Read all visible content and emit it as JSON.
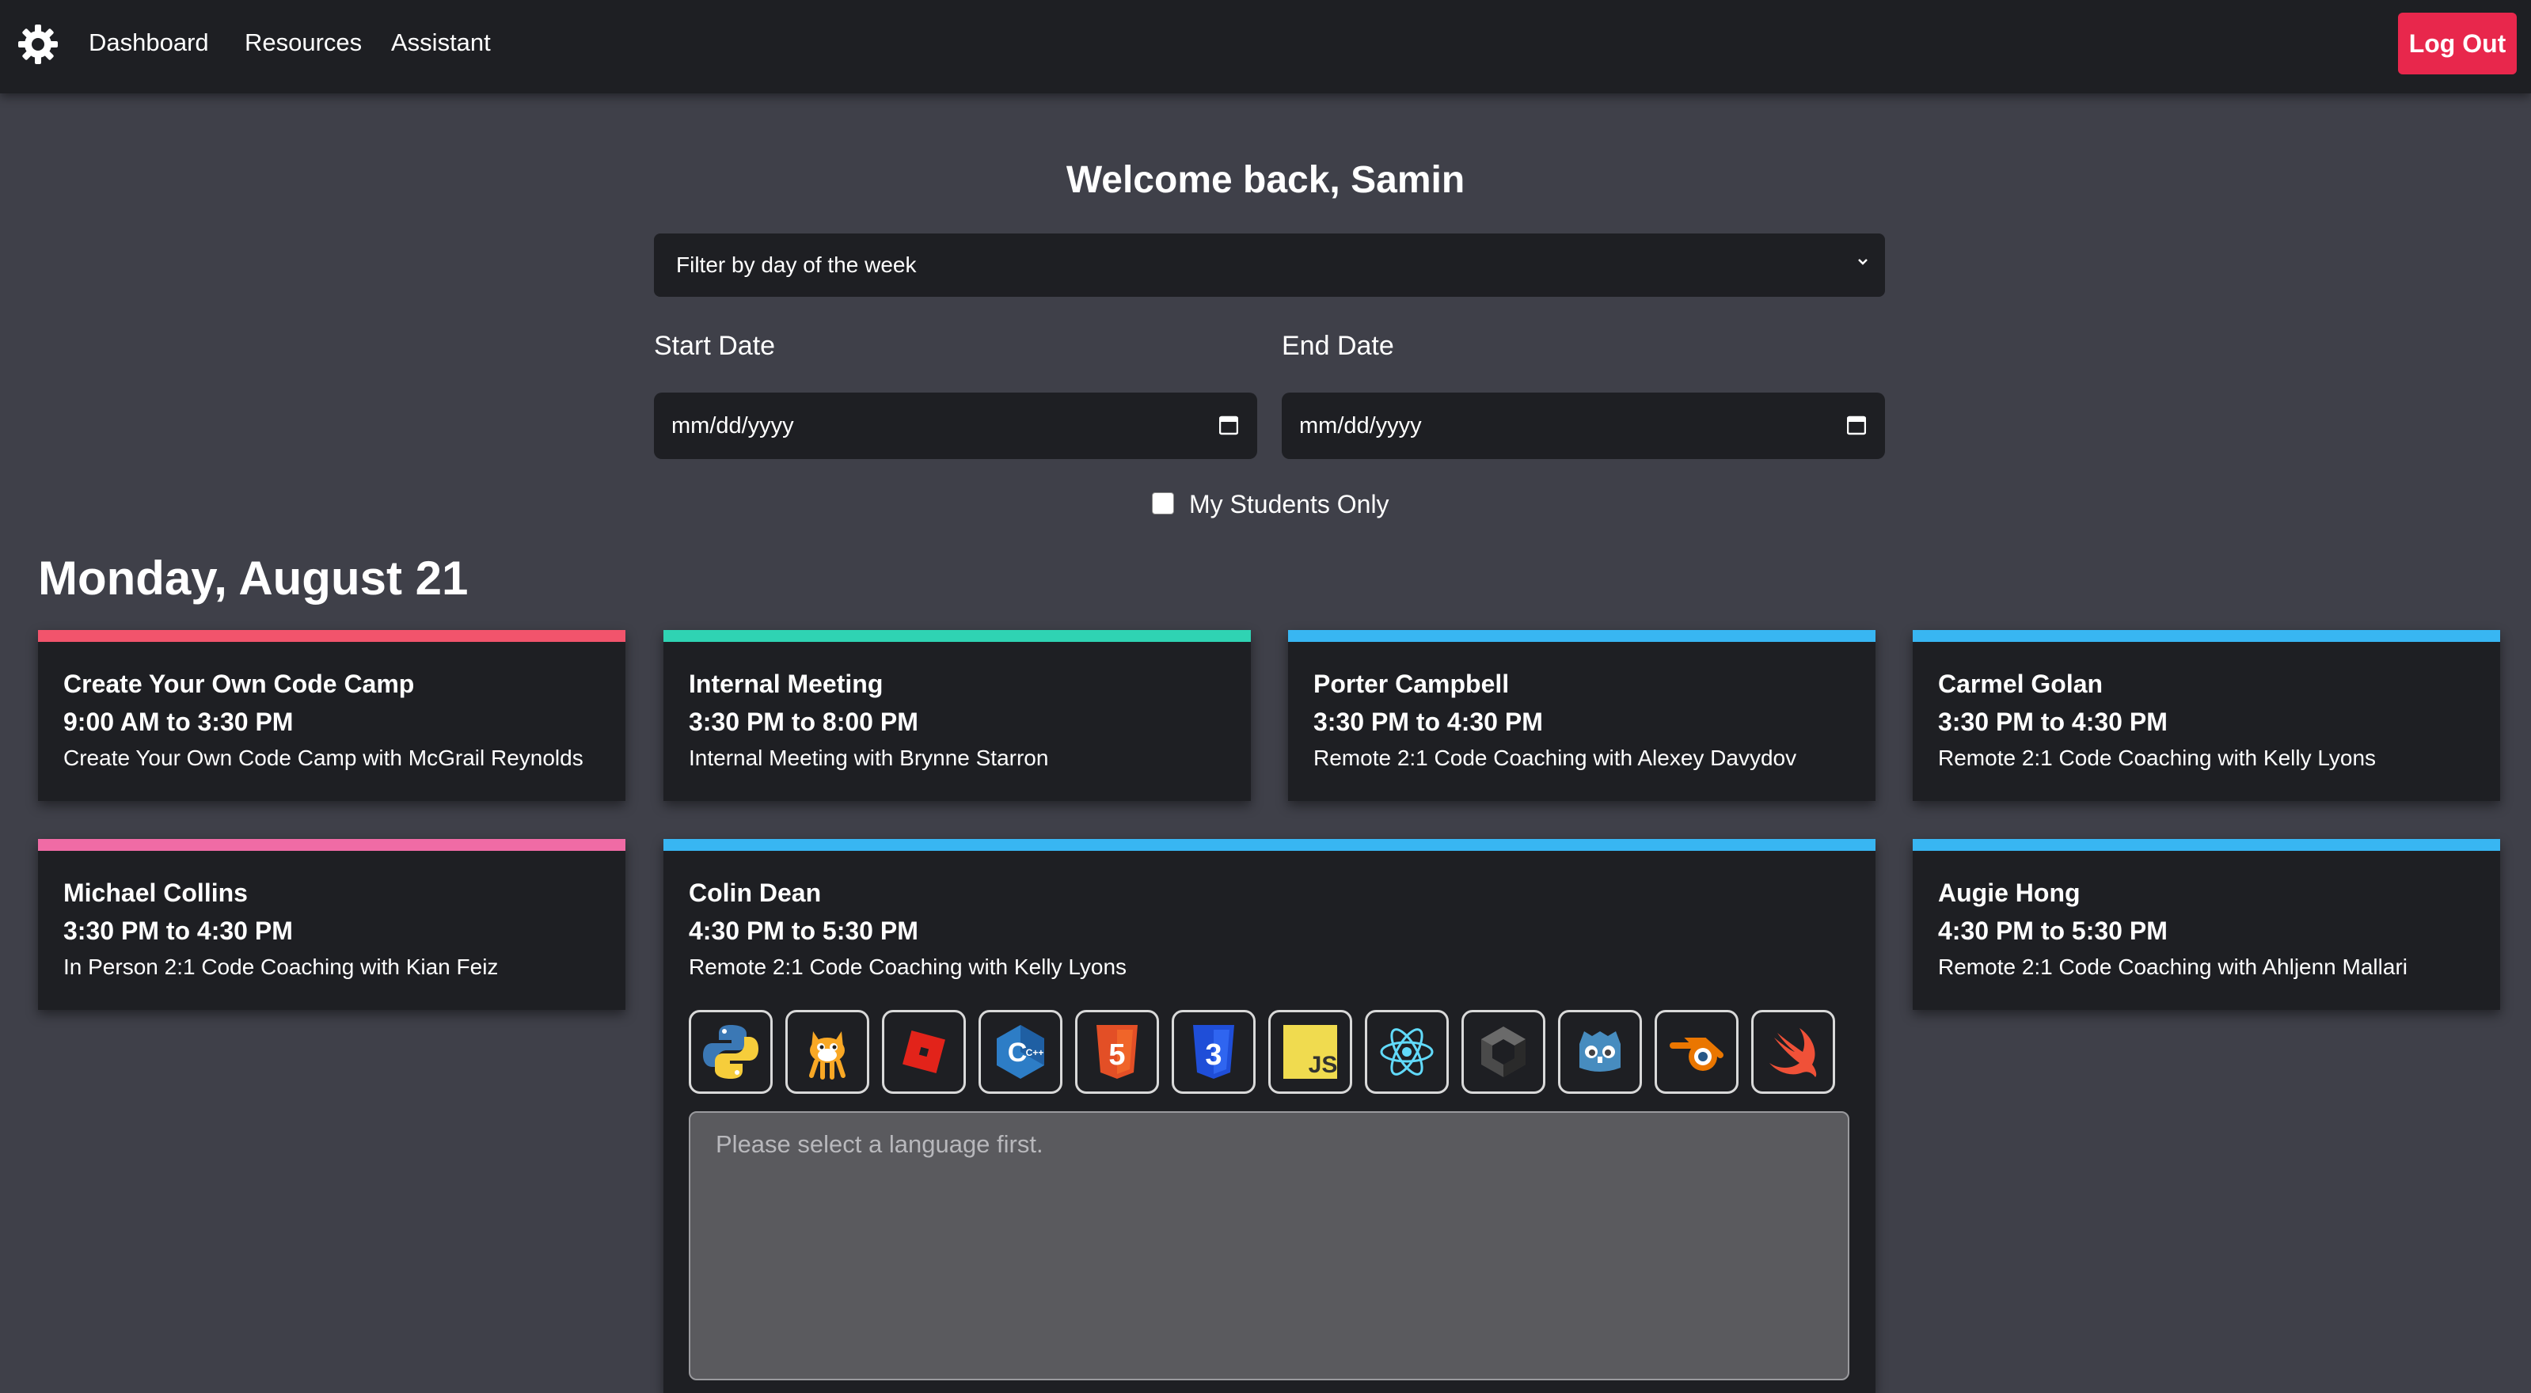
{
  "nav": {
    "links": [
      "Dashboard",
      "Resources",
      "Assistant"
    ],
    "logout_label": "Log Out"
  },
  "welcome": "Welcome back, Samin",
  "filter": {
    "placeholder": "Filter by day of the week"
  },
  "dates": {
    "start_label": "Start Date",
    "end_label": "End Date",
    "start_value": "mm/dd/yyyy",
    "end_value": "mm/dd/yyyy"
  },
  "my_students_label": "My Students Only",
  "day_heading": "Monday, August 21",
  "colors": {
    "accent_red": "#e8274c",
    "bar_pink_red": "#f2546c",
    "bar_teal": "#2fd3b3",
    "bar_blue": "#38b6f2",
    "bar_pink": "#f06ba5"
  },
  "events": [
    {
      "name": "Create Your Own Code Camp",
      "time": "9:00 AM to 3:30 PM",
      "desc": "Create Your Own Code Camp with McGrail Reynolds",
      "bar": "#f2546c"
    },
    {
      "name": "Internal Meeting",
      "time": "3:30 PM to 8:00 PM",
      "desc": "Internal Meeting with Brynne Starron",
      "bar": "#2fd3b3"
    },
    {
      "name": "Porter Campbell",
      "time": "3:30 PM to 4:30 PM",
      "desc": "Remote 2:1 Code Coaching with Alexey Davydov",
      "bar": "#38b6f2"
    },
    {
      "name": "Carmel Golan",
      "time": "3:30 PM to 4:30 PM",
      "desc": "Remote 2:1 Code Coaching with Kelly Lyons",
      "bar": "#38b6f2"
    },
    {
      "name": "Michael Collins",
      "time": "3:30 PM to 4:30 PM",
      "desc": "In Person 2:1 Code Coaching with Kian Feiz",
      "bar": "#f06ba5"
    },
    {
      "name": "Colin Dean",
      "time": "4:30 PM to 5:30 PM",
      "desc": "Remote 2:1 Code Coaching with Kelly Lyons",
      "bar": "#38b6f2"
    },
    {
      "name": "Augie Hong",
      "time": "4:30 PM to 5:30 PM",
      "desc": "Remote 2:1 Code Coaching with Ahljenn Mallari",
      "bar": "#38b6f2"
    }
  ],
  "languages": [
    "python-icon",
    "scratch-icon",
    "roblox-icon",
    "cpp-icon",
    "html5-icon",
    "css3-icon",
    "javascript-icon",
    "react-icon",
    "unity-icon",
    "godot-icon",
    "blender-icon",
    "swift-icon"
  ],
  "language_badges": {
    "cpp": "C++",
    "html5": "5",
    "css3": "3",
    "javascript": "JS"
  },
  "assistant": {
    "placeholder": "Please select a language first."
  }
}
